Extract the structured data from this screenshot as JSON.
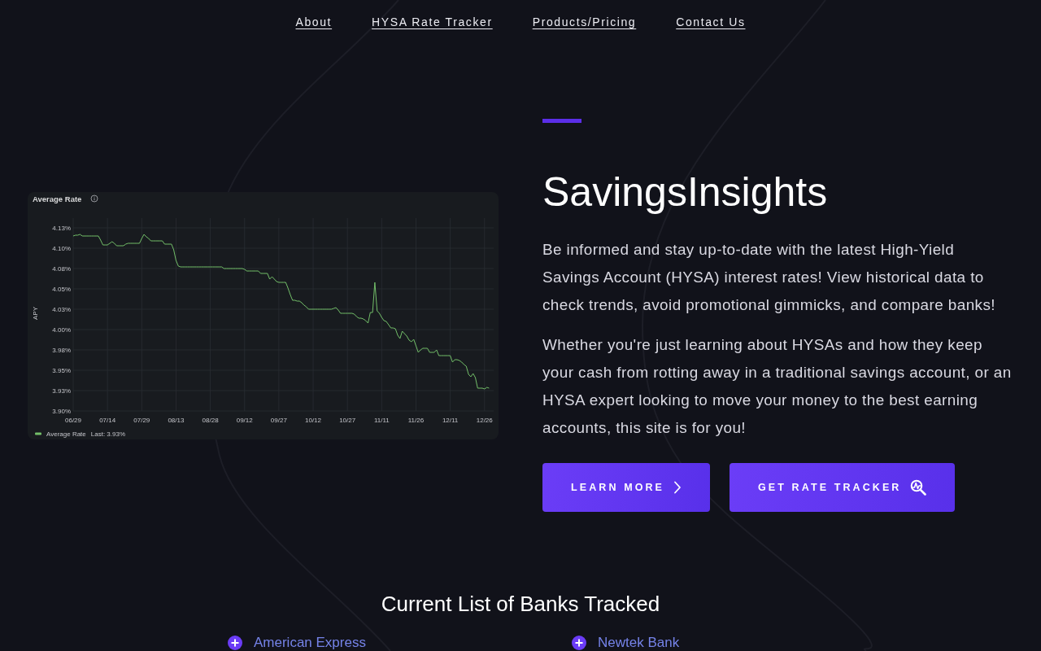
{
  "nav_links": [
    "About",
    "HYSA Rate Tracker",
    "Products/Pricing",
    "Contact Us"
  ],
  "hero": {
    "chart": {
      "legend_reading": "Last: 3.93%",
      "chart_data": {
        "type": "line",
        "title": "Average Rate",
        "ylabel": "APY",
        "grid": true,
        "categories": [
          "06/29",
          null,
          null,
          null,
          null,
          null,
          null,
          null,
          null,
          null,
          null,
          null,
          null,
          null,
          null,
          "07/14",
          null,
          null,
          null,
          null,
          null,
          null,
          null,
          null,
          null,
          null,
          null,
          null,
          null,
          null,
          "07/29",
          null,
          null,
          null,
          null,
          null,
          null,
          null,
          null,
          null,
          null,
          null,
          null,
          null,
          null,
          "08/13",
          null,
          null,
          null,
          null,
          null,
          null,
          null,
          null,
          null,
          null,
          null,
          null,
          null,
          null,
          "08/28",
          null,
          null,
          null,
          null,
          null,
          null,
          null,
          null,
          null,
          null,
          null,
          null,
          null,
          null,
          "09/12",
          null,
          null,
          null,
          null,
          null,
          null,
          null,
          null,
          null,
          null,
          null,
          null,
          null,
          null,
          "09/27",
          null,
          null,
          null,
          null,
          null,
          null,
          null,
          null,
          null,
          null,
          null,
          null,
          null,
          null,
          "10/12",
          null,
          null,
          null,
          null,
          null,
          null,
          null,
          null,
          null,
          null,
          null,
          null,
          null,
          null,
          "10/27",
          null,
          null,
          null,
          null,
          null,
          null,
          null,
          null,
          null,
          null,
          null,
          null,
          null,
          null,
          "11/11",
          null,
          null,
          null,
          null,
          null,
          null,
          null,
          null,
          null,
          null,
          null,
          null,
          null,
          null,
          "11/26",
          null,
          null,
          null,
          null,
          null,
          null,
          null,
          null,
          null,
          null,
          null,
          null,
          null,
          null,
          "12/11",
          null,
          null,
          null,
          null,
          null,
          null,
          null,
          null,
          null,
          null,
          null,
          null,
          null,
          null,
          "12/26",
          null,
          null
        ],
        "series": [
          {
            "name": "Average Rate",
            "color": "#73bf69",
            "values": [
              4.115,
              4.116,
              4.116,
              4.117,
              4.115,
              4.115,
              4.115,
              4.115,
              4.115,
              4.115,
              4.115,
              4.115,
              4.11,
              4.104,
              4.104,
              4.104,
              4.106,
              4.108,
              4.106,
              4.103,
              4.103,
              4.103,
              4.103,
              4.105,
              4.106,
              4.106,
              4.106,
              4.106,
              4.106,
              4.106,
              4.112,
              4.117,
              4.114,
              4.112,
              4.109,
              4.109,
              4.109,
              4.109,
              4.109,
              4.109,
              4.105,
              4.105,
              4.105,
              4.105,
              4.098,
              4.085,
              4.078,
              4.077,
              4.077,
              4.077,
              4.077,
              4.077,
              4.077,
              4.077,
              4.077,
              4.077,
              4.077,
              4.077,
              4.077,
              4.077,
              4.077,
              4.077,
              4.077,
              4.077,
              4.077,
              4.077,
              4.075,
              4.075,
              4.075,
              4.075,
              4.075,
              4.075,
              4.075,
              4.075,
              4.075,
              4.074,
              4.072,
              4.072,
              4.072,
              4.072,
              4.072,
              4.072,
              4.069,
              4.069,
              4.069,
              4.069,
              4.062,
              4.065,
              4.062,
              4.059,
              4.058,
              4.058,
              4.058,
              4.058,
              4.051,
              4.043,
              4.036,
              4.036,
              4.035,
              4.035,
              4.033,
              4.03,
              4.028,
              4.025,
              4.025,
              4.025,
              4.025,
              4.025,
              4.025,
              4.025,
              4.025,
              4.025,
              4.025,
              4.025,
              4.026,
              4.027,
              4.024,
              4.02,
              4.02,
              4.02,
              4.02,
              4.02,
              4.02,
              4.019,
              4.016,
              4.014,
              4.014,
              4.013,
              4.011,
              4.008,
              4.021,
              4.021,
              4.058,
              4.023,
              4.02,
              4.015,
              4.011,
              4.01,
              4.006,
              4.002,
              4.002,
              4.001,
              3.993,
              3.989,
              3.998,
              3.995,
              3.992,
              3.987,
              3.985,
              3.988,
              3.98,
              3.972,
              3.975,
              3.977,
              3.977,
              3.977,
              3.972,
              3.972,
              3.972,
              3.975,
              3.968,
              3.968,
              3.968,
              3.968,
              3.968,
              3.968,
              3.96,
              3.963,
              3.963,
              3.962,
              3.96,
              3.957,
              3.955,
              3.945,
              3.942,
              3.946,
              3.941,
              3.928,
              3.928,
              3.928,
              3.927,
              3.929,
              3.928
            ]
          }
        ],
        "ylim": [
          3.9,
          4.137
        ],
        "yticks": [
          {
            "value": 3.9,
            "label": "3.90%"
          },
          {
            "value": 3.925,
            "label": "3.93%"
          },
          {
            "value": 3.95,
            "label": "3.95%"
          },
          {
            "value": 3.975,
            "label": "3.98%"
          },
          {
            "value": 4.0,
            "label": "4.00%"
          },
          {
            "value": 4.025,
            "label": "4.03%"
          },
          {
            "value": 4.05,
            "label": "4.05%"
          },
          {
            "value": 4.075,
            "label": "4.08%"
          },
          {
            "value": 4.1,
            "label": "4.10%"
          },
          {
            "value": 4.125,
            "label": "4.13%"
          }
        ]
      }
    },
    "title": "SavingsInsights",
    "paragraphs": [
      "Be informed and stay up-to-date with the latest High-Yield Savings Account (HYSA) interest rates! View historical data to check trends, avoid promotional gimmicks, and compare banks!",
      "Whether you're just learning about HYSAs and how they keep your cash from rotting away in a traditional savings account, or an HYSA expert looking to move your money to the best earning accounts, this site is for you!"
    ],
    "buttons": [
      {
        "label": "LEARN MORE",
        "kind": "more"
      },
      {
        "label": "GET RATE TRACKER",
        "kind": "tracker"
      }
    ]
  },
  "banks": {
    "heading": "Current List of Banks Tracked",
    "items": [
      {
        "name": "American Express"
      },
      {
        "name": "Newtek Bank"
      }
    ]
  }
}
